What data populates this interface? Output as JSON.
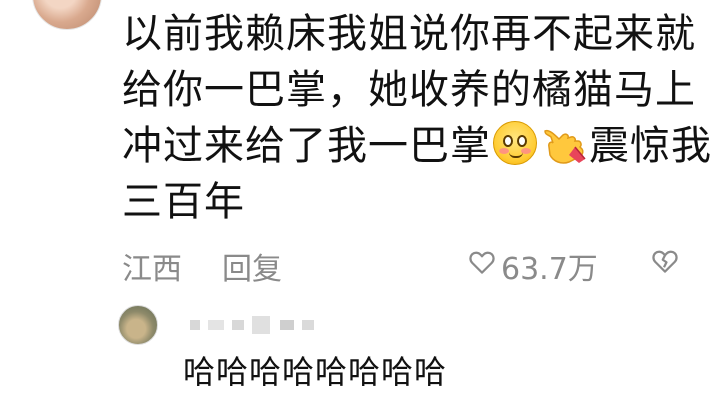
{
  "comment": {
    "lines": [
      "以前我赖床我姐说你再不起来就",
      "给你一巴掌，她收养的橘猫马上",
      "冲过来给了我一巴掌",
      "震惊我",
      "三百年"
    ],
    "emojis": [
      "blushing-face-icon",
      "pointing-hand-icon"
    ]
  },
  "meta": {
    "location": "江西",
    "reply_label": "回复",
    "like_count": "63.7万"
  },
  "reply": {
    "text": "哈哈哈哈哈哈哈哈"
  },
  "colors": {
    "text": "#111111",
    "meta": "#8a8a8a",
    "background": "#ffffff"
  }
}
